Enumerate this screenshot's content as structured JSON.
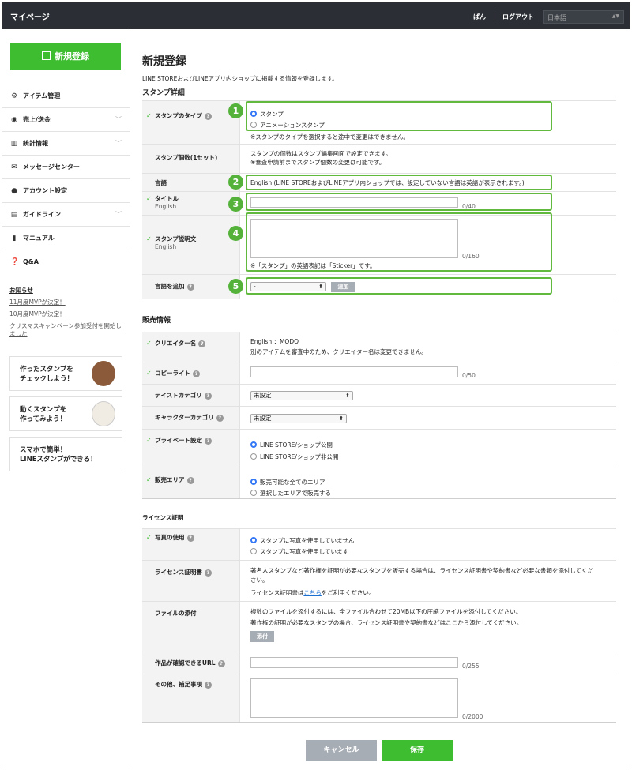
{
  "topbar": {
    "title": "マイページ",
    "user": "ぱん",
    "logout": "ログアウト",
    "language": "日本語"
  },
  "sidebar": {
    "new_button": "新規登録",
    "items": [
      {
        "label": "アイテム管理",
        "icon": "gear-icon"
      },
      {
        "label": "売上/送金",
        "icon": "coins-icon"
      },
      {
        "label": "統計情報",
        "icon": "bar-chart-icon"
      },
      {
        "label": "メッセージセンター",
        "icon": "mail-icon"
      },
      {
        "label": "アカウント設定",
        "icon": "person-icon"
      },
      {
        "label": "ガイドライン",
        "icon": "book-icon"
      },
      {
        "label": "マニュアル",
        "icon": "document-icon"
      },
      {
        "label": "Q&A",
        "icon": "speech-bubble-icon"
      }
    ],
    "notices": {
      "heading": "お知らせ",
      "links": [
        "11月度MVPが決定！",
        "10月度MVPが決定！",
        "クリスマスキャンペーン参加受付を開始しました"
      ]
    },
    "promos": [
      {
        "line1": "作ったスタンプを",
        "line2": "チェックしよう！"
      },
      {
        "line1": "動くスタンプを",
        "line2": "作ってみよう！"
      },
      {
        "line1": "スマホで簡単！",
        "line2": "LINEスタンプができる！"
      }
    ]
  },
  "page": {
    "title": "新規登録",
    "description": "LINE STOREおよびLINEアプリ内ショップに掲載する情報を登録します。"
  },
  "sticker_details": {
    "heading": "スタンプ詳細",
    "type": {
      "label": "スタンプのタイプ",
      "options": [
        "スタンプ",
        "アニメーションスタンプ"
      ],
      "note": "※スタンプのタイプを選択すると途中で変更はできません。"
    },
    "count": {
      "label": "スタンプ個数(1セット)",
      "line1": "スタンプの個数はスタンプ編集画面で設定できます。",
      "line2": "※審査申請前までスタンプ個数の変更は可能です。"
    },
    "language": {
      "label": "言語",
      "value": "English (LINE STOREおよびLINEアプリ内ショップでは、設定していない言語は英語が表示されます。)"
    },
    "title": {
      "label": "タイトル",
      "sub": "English",
      "value": "",
      "counter": "0/40"
    },
    "description": {
      "label": "スタンプ説明文",
      "sub": "English",
      "value": "",
      "counter": "0/160",
      "note": "※「スタンプ」の英語表記は「Sticker」です。"
    },
    "add_language": {
      "label": "言語を追加",
      "selected": "-",
      "button": "追加"
    }
  },
  "sales_info": {
    "heading": "販売情報",
    "creator": {
      "label": "クリエイター名",
      "value": "English ：MODO",
      "note": "別のアイテムを審査中のため、クリエイター名は変更できません。"
    },
    "copyright": {
      "label": "コピーライト",
      "value": "",
      "counter": "0/50"
    },
    "taste": {
      "label": "テイストカテゴリ",
      "selected": "未設定"
    },
    "character": {
      "label": "キャラクターカテゴリ",
      "selected": "未設定"
    },
    "private": {
      "label": "プライベート設定",
      "options": [
        "LINE STORE/ショップ公開",
        "LINE STORE/ショップ非公開"
      ]
    },
    "area": {
      "label": "販売エリア",
      "options": [
        "販売可能な全てのエリア",
        "選択したエリアで販売する"
      ]
    }
  },
  "license": {
    "heading": "ライセンス証明",
    "photo": {
      "label": "写真の使用",
      "options": [
        "スタンプに写真を使用していません",
        "スタンプに写真を使用しています"
      ]
    },
    "certificate": {
      "label": "ライセンス証明書",
      "line1": "著名人スタンプなど著作権を証明が必要なスタンプを販売する場合は、ライセンス証明書や契約書など必要な書類を添付してくだ",
      "line2": "さい。",
      "line3_pre": "ライセンス証明書は",
      "line3_link": "こちら",
      "line3_post": "をご利用ください。"
    },
    "file": {
      "label": "ファイルの添付",
      "line1": "複数のファイルを添付するには、全ファイル合わせて20MB以下の圧縮ファイルを添付してください。",
      "line2": "著作権の証明が必要なスタンプの場合、ライセンス証明書や契約書などはここから添付してください。",
      "button": "添付"
    },
    "url": {
      "label": "作品が確認できるURL",
      "value": "",
      "counter": "0/255"
    },
    "other": {
      "label": "その他、補足事項",
      "value": "",
      "counter": "0/2000"
    }
  },
  "footer": {
    "cancel": "キャンセル",
    "save": "保存"
  },
  "annotations": [
    "1",
    "2",
    "3",
    "4",
    "5"
  ],
  "colors": {
    "accent": "#3dbd2f",
    "highlight": "#61b93e",
    "topbar": "#2b2f35",
    "radio": "#3478f6"
  }
}
